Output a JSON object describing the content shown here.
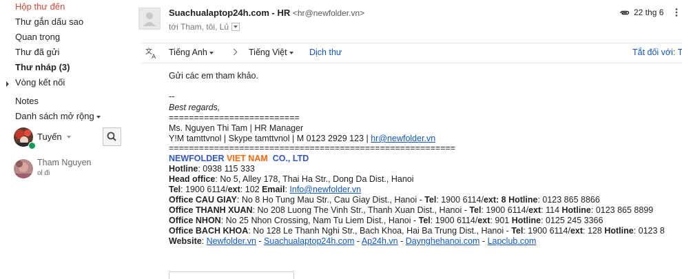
{
  "sidebar": {
    "items": [
      {
        "label": "Hộp thư đến"
      },
      {
        "label": "Thư gắn dấu sao"
      },
      {
        "label": "Quan trọng"
      },
      {
        "label": "Thư đã gửi"
      },
      {
        "label": "Thư nháp (3)"
      },
      {
        "label": "Vòng kết nối"
      },
      {
        "label": "Notes"
      },
      {
        "label": "Danh sách mở rộng"
      }
    ],
    "chat_user": "Tuyến",
    "contact": {
      "name": "Tham Nguyen",
      "status": "ol đi"
    }
  },
  "message": {
    "sender_name": "Suachualaptop24h.com - HR",
    "sender_email": "<hr@newfolder.vn>",
    "to": "tới Tham, tôi, Lủ",
    "date": "22 thg 6"
  },
  "translate": {
    "source": "Tiếng Anh",
    "target": "Tiếng Việt",
    "action": "Dịch thư",
    "right": "Tắt đối với: T"
  },
  "body": {
    "greeting": "Gửi các em tham khảo.",
    "dashes": "--",
    "regards": "Best regards,",
    "sep1": "==========================",
    "name_line": "Ms. Nguyen Thi Tam | HR Manager",
    "contact_line_prefix": "Y!M tamttvnol | Skype tamttvnol | M 0123 2929 123 | ",
    "contact_email": "hr@newfolder.vn",
    "sep2": "=========================================================",
    "brand_a": "NEWFOLDER ",
    "brand_b": "VIET NAM",
    "brand_c": "  CO., LTD",
    "hotline_label": "Hotline",
    "hotline_value": ": 0938 115 333",
    "head_label": "Head office",
    "head_value": ": No 5, Alley 178, Thai Ha Str., Dong Da Dist., Hanoi",
    "tel_label": "Tel",
    "tel_value": ": 1900 6114/",
    "ext_label": "ext",
    "ext_value": ": 102 ",
    "email_label": "Email",
    "email_sep": ": ",
    "email_link": "Info@newfolder.vn",
    "offices": [
      {
        "name": "Office CAU GIAY",
        "addr": ": No 8 Ho Tung Mau Str., Cau Giay Dist., Hanoi - ",
        "tel": ": 1900 6114/",
        "ext": ": 8 ",
        "hotline": ": 0123 865 8866",
        "ext_bold": true
      },
      {
        "name": "Office THANH XUAN",
        "addr": ": No 208 Luong The Vinh Str., Thanh Xuan Dist., Hanoi - ",
        "tel": ": 1900 6114/",
        "ext": ": 114 ",
        "hotline": ": 0123 865 8899",
        "ext_bold": false
      },
      {
        "name": "Office NHON",
        "addr": ": No 25 Nhon Crossing, Nam Tu Liem Dist., Hanoi - ",
        "tel": ": 1900 6114/",
        "ext": ": 901 ",
        "hotline": ": 0125 245 3366",
        "ext_bold": false
      },
      {
        "name": "Office BACH KHOA",
        "addr": ": No 128 Le Thanh Nghi Str., Bach Khoa, Hai Ba Trung Dist., Hanoi - ",
        "tel": ": 1900 6114/",
        "ext": ": 128 ",
        "hotline": ": 0123 8",
        "ext_bold": false
      }
    ],
    "tel_word": "Tel",
    "ext_word": "ext",
    "hotline_word": "Hotline",
    "website_label": "Website",
    "website_sep": ": ",
    "websites": [
      "Newfolder.vn",
      "Suachualaptop24h.com",
      "Ap24h.vn",
      "Daynghehanoi.com",
      "Lapclub.com"
    ],
    "website_joiner": " - "
  }
}
